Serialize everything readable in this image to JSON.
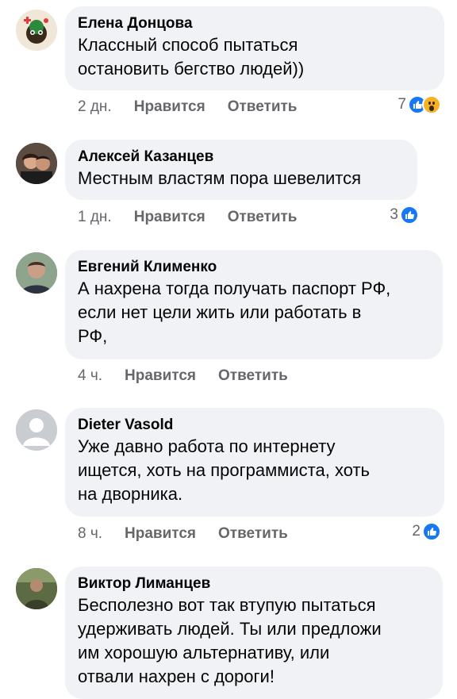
{
  "comments": [
    {
      "author": "Елена Донцова",
      "text": "Классный способ пытаться\nостановить бегство людей))",
      "time": "2 дн.",
      "like_label": "Нравится",
      "reply_label": "Ответить",
      "reaction_count": "7",
      "reactions": [
        "like-icon",
        "wow-icon"
      ]
    },
    {
      "author": "Алексей Казанцев",
      "text": "Местным властям пора шевелится",
      "time": "1 дн.",
      "like_label": "Нравится",
      "reply_label": "Ответить",
      "reaction_count": "3",
      "reactions": [
        "like-icon"
      ]
    },
    {
      "author": "Евгений Клименко",
      "text": "А нахрена тогда получать паспорт РФ,\nесли нет цели жить или работать в\nРФ,",
      "time": "4 ч.",
      "like_label": "Нравится",
      "reply_label": "Ответить",
      "reaction_count": "",
      "reactions": []
    },
    {
      "author": "Dieter Vasold",
      "text": "Уже давно работа по интернету\nищется, хоть на программиста,  хоть\nна дворника.",
      "time": "8 ч.",
      "like_label": "Нравится",
      "reply_label": "Ответить",
      "reaction_count": "2",
      "reactions": [
        "like-icon"
      ]
    },
    {
      "author": "Виктор Лиманцев",
      "text": "Бесполезно вот так втупую пытаться\nудерживать людей. Ты или предложи\nим хорошую альтернативу, или\nотвали нахрен с дороги!",
      "time": "",
      "like_label": "",
      "reply_label": "",
      "reaction_count": "",
      "reactions": []
    }
  ],
  "colors": {
    "bubble": "#f0f2f5",
    "meta": "#65676b",
    "like": "#1877f2",
    "wow": "#f7b125"
  }
}
